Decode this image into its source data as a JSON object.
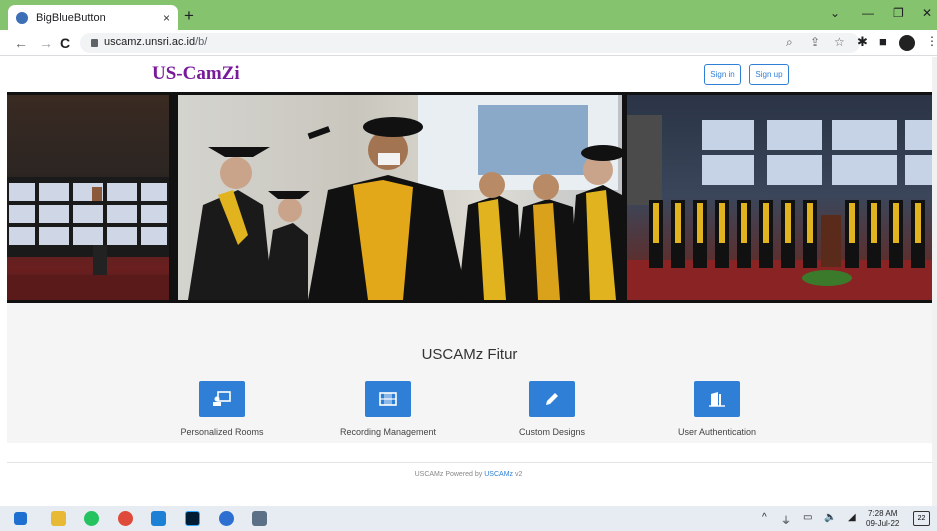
{
  "browser": {
    "tab_title": "BigBlueButton",
    "tab_close": "×",
    "new_tab": "+",
    "url_domain": "uscamz.unsri.ac.id",
    "url_path": "/b/",
    "win_minimize": "—",
    "win_restore": "❐",
    "win_close": "✕",
    "tabs_dropdown": "⌄"
  },
  "site": {
    "logo": "US-CamZi",
    "signin": "Sign in",
    "signup": "Sign up"
  },
  "features": {
    "title": "USCAMz Fitur",
    "items": [
      {
        "label": "Personalized Rooms",
        "icon": "personalized-rooms-icon"
      },
      {
        "label": "Recording Management",
        "icon": "recording-film-icon"
      },
      {
        "label": "Custom Designs",
        "icon": "pencil-icon"
      },
      {
        "label": "User Authentication",
        "icon": "door-icon"
      }
    ]
  },
  "footer": {
    "prefix": "USCAMz Powered by",
    "link": "USCAMz",
    "version": "v2"
  },
  "taskbar": {
    "time": "7:28 AM",
    "date": "09-Jul-22",
    "notifications": "22"
  },
  "colors": {
    "accent": "#2f7fd6",
    "logo": "#7a1a9a",
    "chrome_frame": "#85c36f"
  }
}
